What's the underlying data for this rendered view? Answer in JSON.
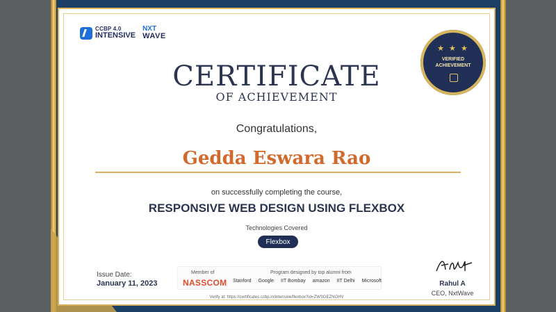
{
  "logos": {
    "ccbp_small": "CCBP 4.0",
    "ccbp_big": "INTENSIVE",
    "nxt_top": "NXT",
    "nxt_bottom": "WAVE"
  },
  "certificate": {
    "title": "CERTIFICATE",
    "subtitle": "OF ACHIEVEMENT",
    "congrats": "Congratulations,",
    "name": "Gedda Eswara Rao",
    "completion_text": "on successfully completing the course,",
    "course": "RESPONSIVE WEB DESIGN USING FLEXBOX",
    "tech_label": "Technologies Covered",
    "tech_item": "Flexbox",
    "issue_label": "Issue Date:",
    "issue_date": "January 11, 2023",
    "member_label": "Member of",
    "nasscom": "NASSCOM",
    "program_label": "Program designed by top alumni from",
    "partners": [
      "Stanford",
      "Google",
      "IIT Bombay",
      "amazon",
      "IIT Delhi",
      "Microsoft"
    ],
    "verify_text": "Verify at: https://certificates.ccbp.in/intensive/flexbox?id=ZWSGEZNGHV",
    "signer": "Rahul A",
    "role": "CEO, NxtWave"
  },
  "badge": {
    "stars": "★ ★ ★",
    "line1": "VERIFIED",
    "line2": "ACHIEVEMENT"
  }
}
